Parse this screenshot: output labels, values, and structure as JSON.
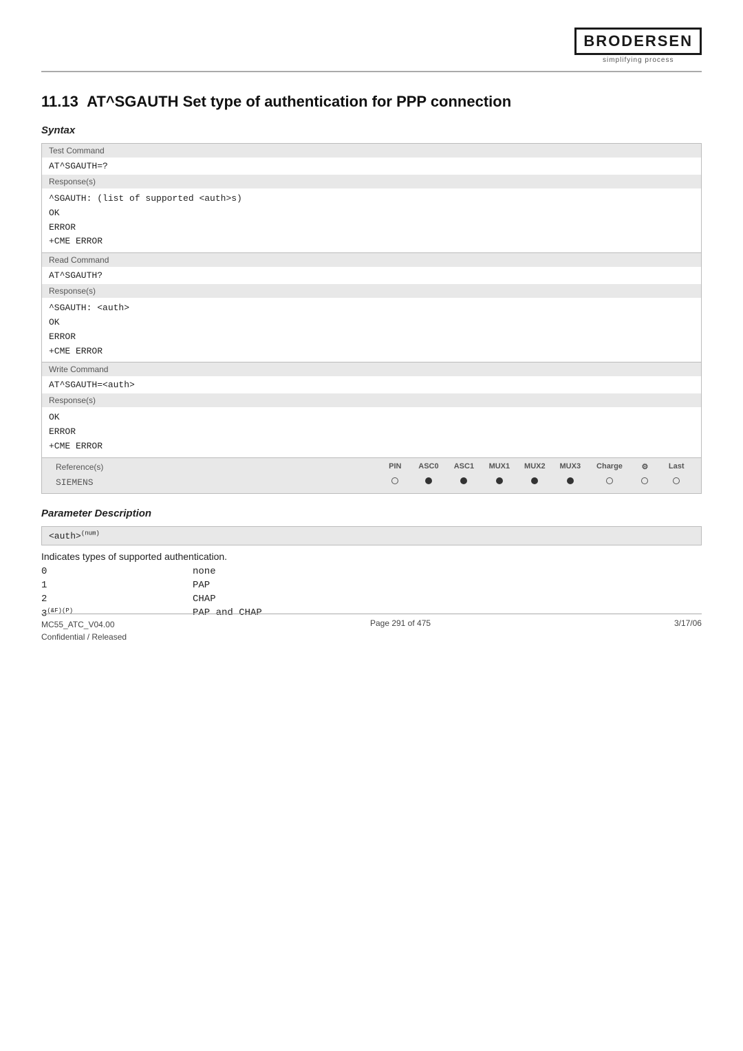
{
  "header": {
    "logo_text": "BRODERSEN",
    "logo_sub": "simplifying process"
  },
  "section": {
    "number": "11.13",
    "title": "AT^SGAUTH   Set type of authentication for PPP connection"
  },
  "syntax": {
    "label": "Syntax",
    "rows": [
      {
        "type": "Test Command",
        "command": "AT^SGAUTH=?",
        "responses_label": "Response(s)",
        "responses": "^SGAUTH:  (list of supported <auth>s)\nOK\nERROR\n+CME ERROR"
      },
      {
        "type": "Read Command",
        "command": "AT^SGAUTH?",
        "responses_label": "Response(s)",
        "responses": "^SGAUTH: <auth>\nOK\nERROR\n+CME ERROR"
      },
      {
        "type": "Write Command",
        "command": "AT^SGAUTH=<auth>",
        "responses_label": "Response(s)",
        "responses": "OK\nERROR\n+CME ERROR"
      }
    ]
  },
  "references": {
    "label": "Reference(s)",
    "columns": [
      "PIN",
      "ASC0",
      "ASC1",
      "MUX1",
      "MUX2",
      "MUX3",
      "Charge",
      "⚙",
      "Last"
    ],
    "rows": [
      {
        "name": "SIEMENS",
        "values": [
          "empty",
          "filled",
          "filled",
          "filled",
          "filled",
          "filled",
          "empty",
          "empty",
          "empty"
        ]
      }
    ]
  },
  "parameter_description": {
    "label": "Parameter Description",
    "param_name": "<auth>",
    "param_super": "(num)",
    "description": "Indicates types of supported authentication.",
    "values": [
      {
        "key": "0",
        "value": "none"
      },
      {
        "key": "1",
        "value": "PAP"
      },
      {
        "key": "2",
        "value": "CHAP"
      },
      {
        "key": "3(&F)(P)",
        "value": "PAP and CHAP"
      }
    ]
  },
  "footer": {
    "left_line1": "MC55_ATC_V04.00",
    "left_line2": "Confidential / Released",
    "center": "Page 291 of 475",
    "right": "3/17/06"
  }
}
